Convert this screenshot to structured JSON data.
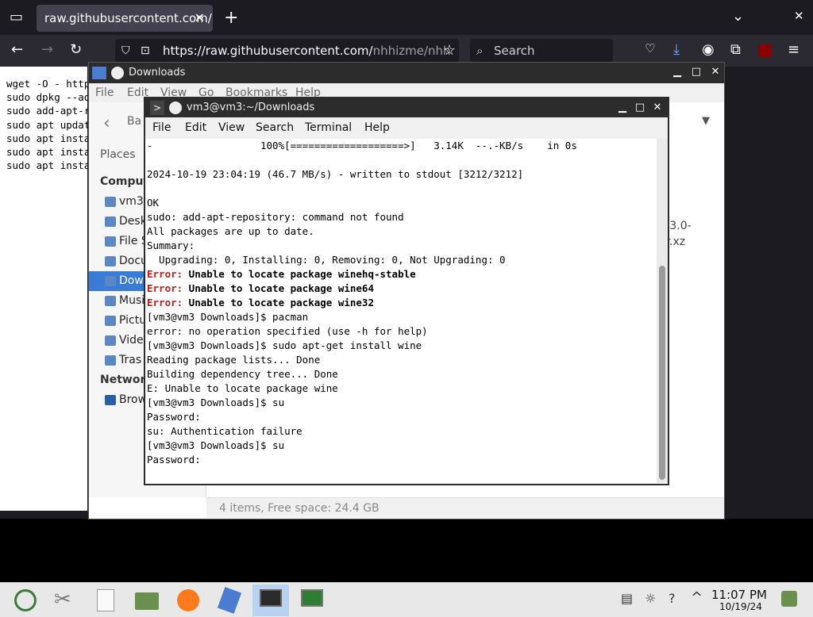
{
  "browser": {
    "tab_title": "raw.githubusercontent.com/",
    "tab_close": "✕",
    "new_tab": "+",
    "url_prefix": "https://raw.githubusercontent.com/",
    "url_rest": "nhhizme/nhh",
    "search_placeholder": "Search",
    "page_lines": [
      "wget -O - http",
      "sudo dpkg --ad",
      "sudo add-apt-r",
      "sudo apt updat",
      "sudo apt insta",
      "sudo apt insta",
      "sudo apt insta"
    ]
  },
  "file_manager": {
    "title": "Downloads",
    "menu": [
      "File",
      "Edit",
      "View",
      "Go",
      "Bookmarks",
      "Help"
    ],
    "back_label": "Ba",
    "places_label": "Places",
    "computer_header": "Comput",
    "network_header": "Networ",
    "sidebar_items": [
      "vm3",
      "Desk",
      "File S",
      "Docu",
      "Dow",
      "Musi",
      "Pictu",
      "Vide",
      "Tras"
    ],
    "network_items": [
      "Brow"
    ],
    "status": "4 items, Free space: 24.4 GB",
    "file_partial_1": "5.3.0-",
    "file_partial_2": "ar.xz"
  },
  "terminal": {
    "title": "vm3@vm3:~/Downloads",
    "menu": [
      "File",
      "Edit",
      "View",
      "Search",
      "Terminal",
      "Help"
    ],
    "lines": [
      {
        "text": "-                  100%[===================>]   3.14K  --.-KB/s    in 0s"
      },
      {
        "text": ""
      },
      {
        "text": "2024-10-19 23:04:19 (46.7 MB/s) - written to stdout [3212/3212]"
      },
      {
        "text": ""
      },
      {
        "text": "OK"
      },
      {
        "text": "sudo: add-apt-repository: command not found"
      },
      {
        "text": "All packages are up to date."
      },
      {
        "text": "Summary:"
      },
      {
        "text": "  Upgrading: 0, Installing: 0, Removing: 0, Not Upgrading: 0"
      },
      {
        "err": "Error:",
        "text": " Unable to locate package winehq-stable"
      },
      {
        "err": "Error:",
        "text": " Unable to locate package wine64"
      },
      {
        "err": "Error:",
        "text": " Unable to locate package wine32"
      },
      {
        "text": "[vm3@vm3 Downloads]$ pacman"
      },
      {
        "text": "error: no operation specified (use -h for help)"
      },
      {
        "text": "[vm3@vm3 Downloads]$ sudo apt-get install wine"
      },
      {
        "text": "Reading package lists... Done"
      },
      {
        "text": "Building dependency tree... Done"
      },
      {
        "text": "E: Unable to locate package wine"
      },
      {
        "text": "[vm3@vm3 Downloads]$ su"
      },
      {
        "text": "Password:"
      },
      {
        "text": "su: Authentication failure"
      },
      {
        "text": "[vm3@vm3 Downloads]$ su"
      },
      {
        "text": "Password:"
      }
    ]
  },
  "taskbar": {
    "time": "11:07 PM",
    "date": "10/19/24"
  }
}
